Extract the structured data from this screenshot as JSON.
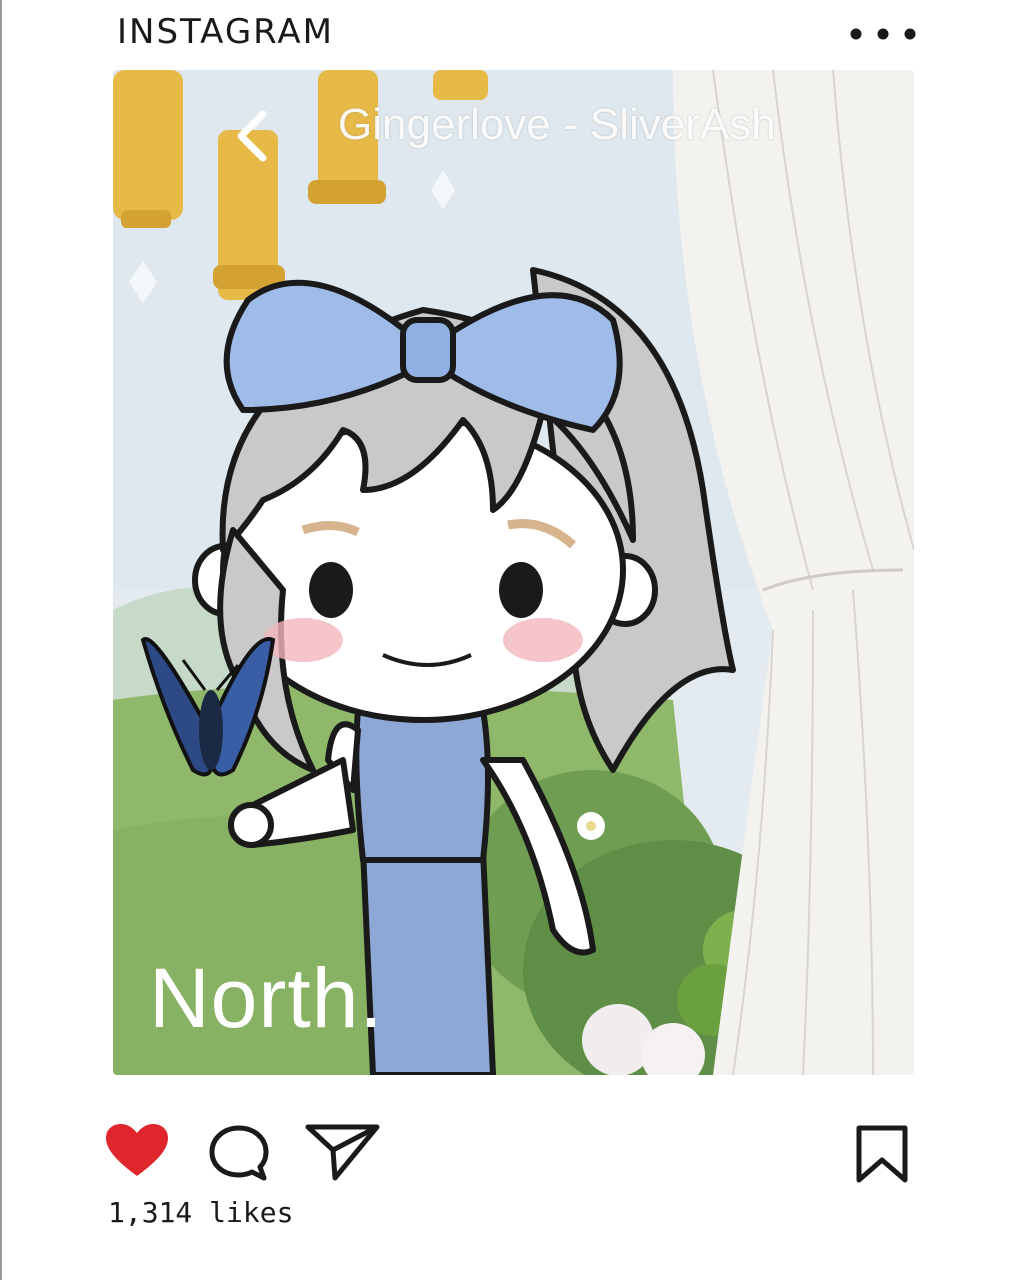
{
  "header": {
    "brand": "INSTAGRAM",
    "more_icon": "more-dots-icon"
  },
  "post": {
    "overlay_title": "Gingerlove - SliverAsh",
    "back_icon": "chevron-left-icon",
    "caption": "North.",
    "colors": {
      "sky": "#dfe8ee",
      "grass": "#8fb86a",
      "bow": "#9fbbe8",
      "hair": "#c9c9c9",
      "outfit": "#8ea8d6",
      "curtain": "#f4f2ef",
      "chandelier": "#e7b946"
    }
  },
  "actions": {
    "like_icon": "heart-icon",
    "comment_icon": "comment-bubble-icon",
    "share_icon": "paper-plane-icon",
    "save_icon": "bookmark-icon",
    "heart_color": "#e0262d"
  },
  "likes_text": "1,314 likes"
}
